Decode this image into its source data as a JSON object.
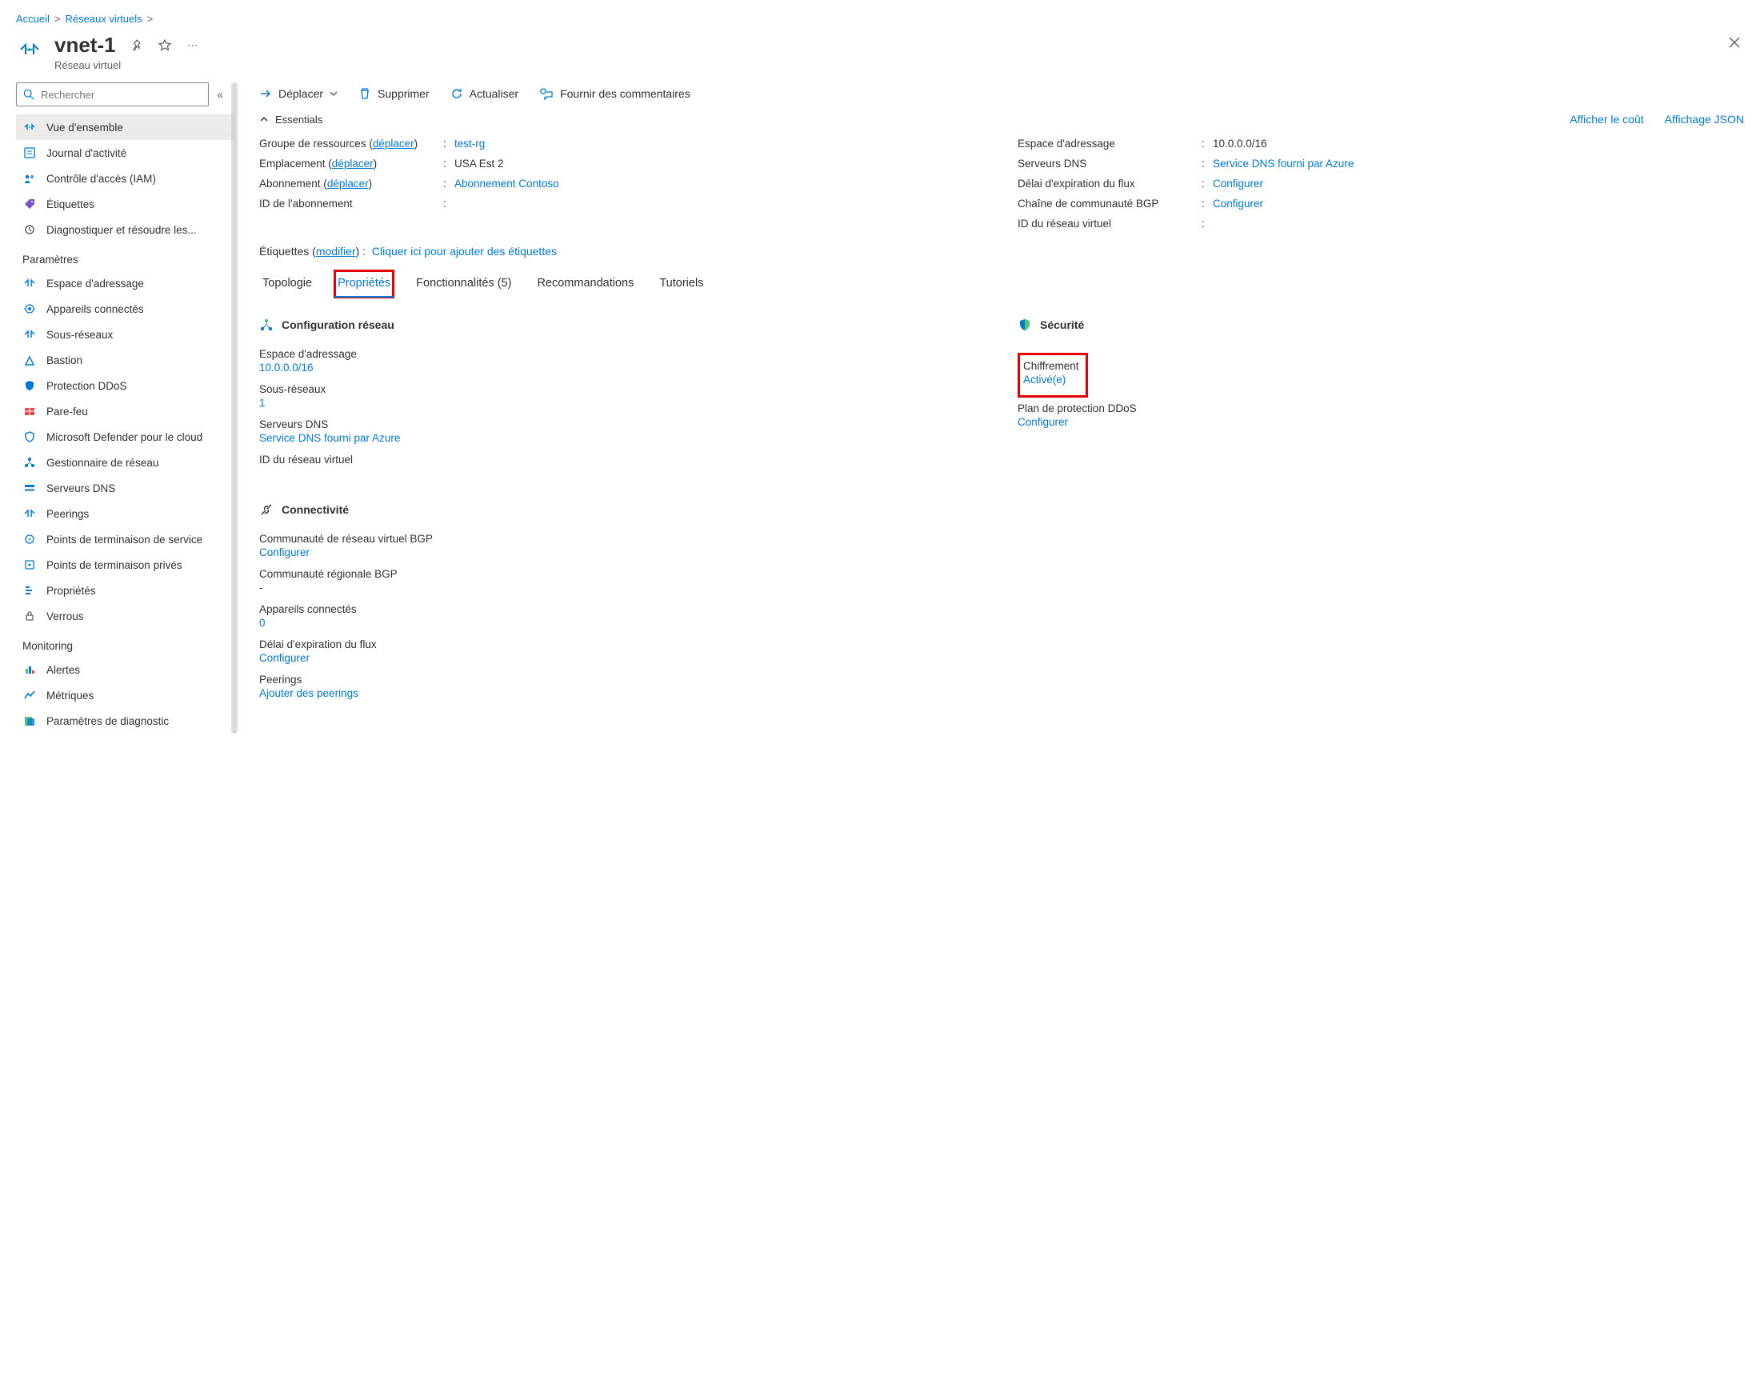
{
  "breadcrumb": {
    "items": [
      "Accueil",
      "Réseaux virtuels"
    ]
  },
  "header": {
    "title": "vnet-1",
    "subtitle": "Réseau virtuel"
  },
  "sidebar": {
    "search_placeholder": "Rechercher",
    "groups": [
      {
        "heading": null,
        "items": [
          {
            "label": "Vue d'ensemble",
            "icon": "overview",
            "selected": true
          },
          {
            "label": "Journal d'activité",
            "icon": "activitylog"
          },
          {
            "label": "Contrôle d'accès (IAM)",
            "icon": "iam"
          },
          {
            "label": "Étiquettes",
            "icon": "tags"
          },
          {
            "label": "Diagnostiquer et résoudre les...",
            "icon": "diagnose"
          }
        ]
      },
      {
        "heading": "Paramètres",
        "items": [
          {
            "label": "Espace d'adressage",
            "icon": "address"
          },
          {
            "label": "Appareils connectés",
            "icon": "devices"
          },
          {
            "label": "Sous-réseaux",
            "icon": "subnets"
          },
          {
            "label": "Bastion",
            "icon": "bastion"
          },
          {
            "label": "Protection DDoS",
            "icon": "ddos"
          },
          {
            "label": "Pare-feu",
            "icon": "firewall"
          },
          {
            "label": "Microsoft Defender pour le cloud",
            "icon": "defender"
          },
          {
            "label": "Gestionnaire de réseau",
            "icon": "netmgr"
          },
          {
            "label": "Serveurs DNS",
            "icon": "dns"
          },
          {
            "label": "Peerings",
            "icon": "peerings"
          },
          {
            "label": "Points de terminaison de service",
            "icon": "svcendpoints"
          },
          {
            "label": "Points de terminaison privés",
            "icon": "privendpoints"
          },
          {
            "label": "Propriétés",
            "icon": "properties"
          },
          {
            "label": "Verrous",
            "icon": "locks"
          }
        ]
      },
      {
        "heading": "Monitoring",
        "items": [
          {
            "label": "Alertes",
            "icon": "alerts"
          },
          {
            "label": "Métriques",
            "icon": "metrics"
          },
          {
            "label": "Paramètres de diagnostic",
            "icon": "diag"
          }
        ]
      }
    ]
  },
  "toolbar": {
    "move": "Déplacer",
    "delete": "Supprimer",
    "refresh": "Actualiser",
    "feedback": "Fournir des commentaires"
  },
  "essentials": {
    "title": "Essentials",
    "show_cost": "Afficher le coût",
    "json_view": "Affichage JSON",
    "left": [
      {
        "label": "Groupe de ressources (",
        "action": "déplacer",
        "label_after": ")",
        "value": "test-rg",
        "value_is_link": true
      },
      {
        "label": "Emplacement (",
        "action": "déplacer",
        "label_after": ")",
        "value": "USA Est 2"
      },
      {
        "label": "Abonnement (",
        "action": "déplacer",
        "label_after": ")",
        "value": "Abonnement Contoso",
        "value_is_link": true
      },
      {
        "label": "ID de l'abonnement",
        "value": ""
      }
    ],
    "right": [
      {
        "label": "Espace d'adressage",
        "value": "10.0.0.0/16"
      },
      {
        "label": "Serveurs DNS",
        "value": "Service DNS fourni par Azure",
        "value_is_link": true
      },
      {
        "label": "Délai d'expiration du flux",
        "value": "Configurer",
        "value_is_link": true
      },
      {
        "label": "Chaîne de communauté BGP",
        "value": "Configurer",
        "value_is_link": true
      },
      {
        "label": "ID du réseau virtuel",
        "value": ""
      }
    ],
    "tags_label": "Étiquettes (",
    "tags_action": "modifier",
    "tags_label_after": ") :",
    "tags_placeholder": "Cliquer ici pour ajouter des étiquettes"
  },
  "tabs": {
    "items": [
      {
        "label": "Topologie"
      },
      {
        "label": "Propriétés",
        "active": true,
        "boxed": true
      },
      {
        "label": "Fonctionnalités (5)"
      },
      {
        "label": "Recommandations"
      },
      {
        "label": "Tutoriels"
      }
    ]
  },
  "properties": {
    "left": {
      "network_title": "Configuration réseau",
      "rows": [
        {
          "label": "Espace d'adressage",
          "value": "10.0.0.0/16",
          "link": true
        },
        {
          "label": "Sous-réseaux",
          "value": "1",
          "link": true
        },
        {
          "label": "Serveurs DNS",
          "value": "Service DNS fourni par Azure",
          "link": true
        },
        {
          "label": "ID du réseau virtuel",
          "value": ""
        }
      ],
      "conn_title": "Connectivité",
      "conn_rows": [
        {
          "label": "Communauté de réseau virtuel BGP",
          "value": "Configurer",
          "link": true
        },
        {
          "label": "Communauté régionale BGP",
          "value": "-",
          "link": false
        },
        {
          "label": "Appareils connectés",
          "value": "0",
          "link": true
        },
        {
          "label": "Délai d'expiration du flux",
          "value": "Configurer",
          "link": true
        },
        {
          "label": "Peerings",
          "value": "Ajouter des peerings",
          "link": true
        }
      ]
    },
    "right": {
      "sec_title": "Sécurité",
      "enc_label": "Chiffrement",
      "enc_value": "Activé(e)",
      "ddos_label": "Plan de protection DDoS",
      "ddos_value": "Configurer"
    }
  }
}
